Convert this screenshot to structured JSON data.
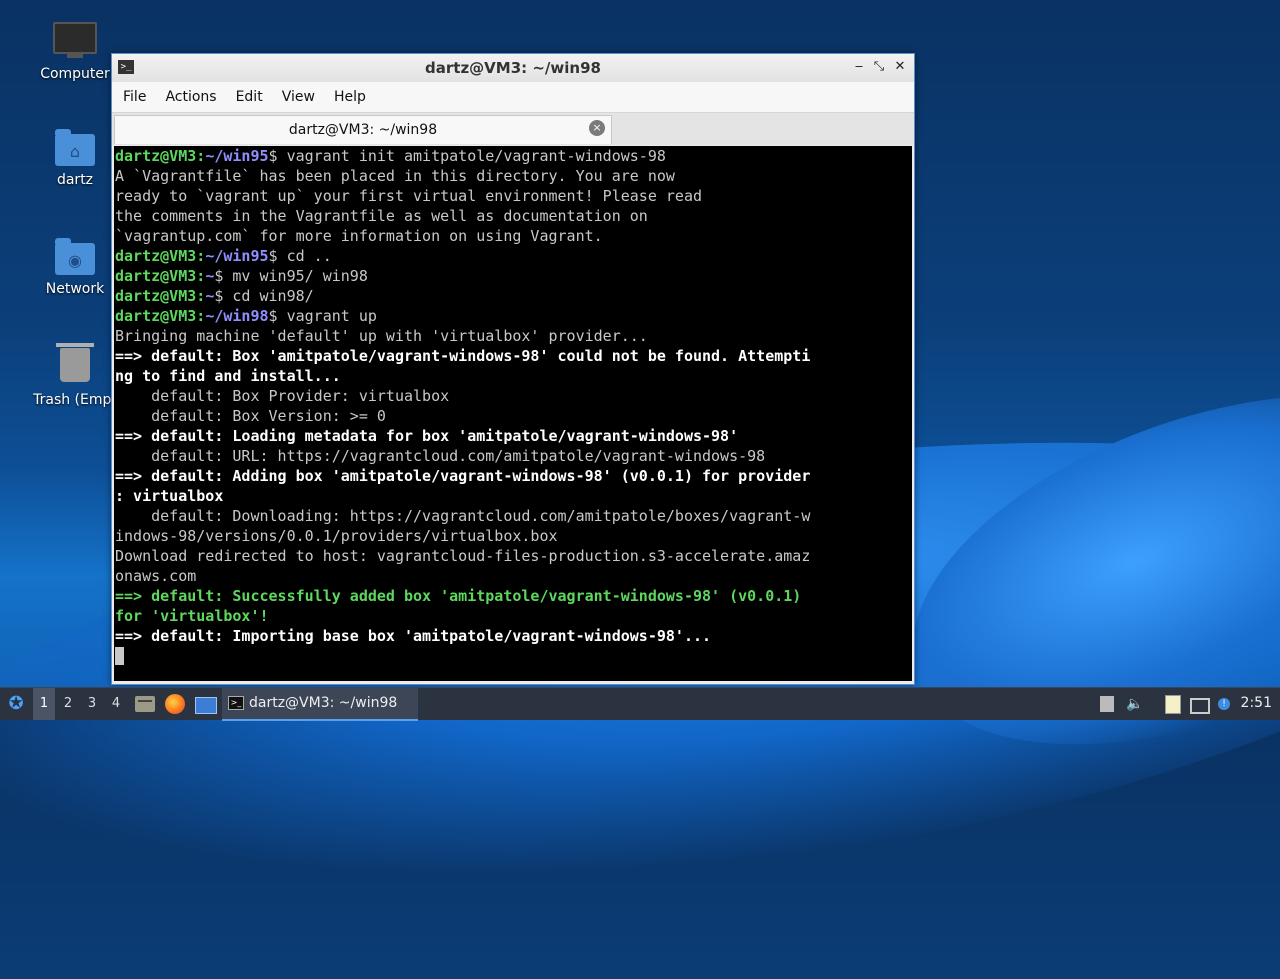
{
  "desktop": {
    "icons": [
      {
        "label": "Computer",
        "icon": "computer-icon"
      },
      {
        "label": "dartz",
        "icon": "home-folder-icon"
      },
      {
        "label": "Network",
        "icon": "network-folder-icon"
      },
      {
        "label": "Trash (Empt",
        "icon": "trash-icon"
      }
    ]
  },
  "window": {
    "title": "dartz@VM3: ~/win98",
    "controls": {
      "minimize": "‒",
      "maximize": "⤡",
      "close": "✕"
    },
    "menu": [
      "File",
      "Actions",
      "Edit",
      "View",
      "Help"
    ],
    "tab": {
      "label": "dartz@VM3: ~/win98",
      "close": "×"
    }
  },
  "terminal": {
    "lines": [
      {
        "type": "prompt",
        "user": "dartz@VM3",
        "path": "~/win95",
        "cmd": " vagrant init amitpatole/vagrant-windows-98"
      },
      {
        "type": "out",
        "text": "A `Vagrantfile` has been placed in this directory. You are now"
      },
      {
        "type": "out",
        "text": "ready to `vagrant up` your first virtual environment! Please read"
      },
      {
        "type": "out",
        "text": "the comments in the Vagrantfile as well as documentation on"
      },
      {
        "type": "out",
        "text": "`vagrantup.com` for more information on using Vagrant."
      },
      {
        "type": "prompt",
        "user": "dartz@VM3",
        "path": "~/win95",
        "cmd": " cd .."
      },
      {
        "type": "prompt",
        "user": "dartz@VM3",
        "path": "~",
        "cmd": " mv win95/ win98"
      },
      {
        "type": "prompt",
        "user": "dartz@VM3",
        "path": "~",
        "cmd": " cd win98/"
      },
      {
        "type": "prompt",
        "user": "dartz@VM3",
        "path": "~/win98",
        "cmd": " vagrant up"
      },
      {
        "type": "out",
        "text": "Bringing machine 'default' up with 'virtualbox' provider..."
      },
      {
        "type": "bold",
        "text": "==> default: Box 'amitpatole/vagrant-windows-98' could not be found. Attempti"
      },
      {
        "type": "bold",
        "text": "ng to find and install..."
      },
      {
        "type": "out",
        "text": "    default: Box Provider: virtualbox"
      },
      {
        "type": "out",
        "text": "    default: Box Version: >= 0"
      },
      {
        "type": "bold",
        "text": "==> default: Loading metadata for box 'amitpatole/vagrant-windows-98'"
      },
      {
        "type": "out",
        "text": "    default: URL: https://vagrantcloud.com/amitpatole/vagrant-windows-98"
      },
      {
        "type": "bold",
        "text": "==> default: Adding box 'amitpatole/vagrant-windows-98' (v0.0.1) for provider"
      },
      {
        "type": "bold",
        "text": ": virtualbox"
      },
      {
        "type": "out",
        "text": "    default: Downloading: https://vagrantcloud.com/amitpatole/boxes/vagrant-w"
      },
      {
        "type": "out",
        "text": "indows-98/versions/0.0.1/providers/virtualbox.box"
      },
      {
        "type": "out",
        "text": "Download redirected to host: vagrantcloud-files-production.s3-accelerate.amaz"
      },
      {
        "type": "out",
        "text": "onaws.com"
      },
      {
        "type": "green",
        "text": "==> default: Successfully added box 'amitpatole/vagrant-windows-98' (v0.0.1)"
      },
      {
        "type": "green",
        "text": "for 'virtualbox'!"
      },
      {
        "type": "bold",
        "text": "==> default: Importing base box 'amitpatole/vagrant-windows-98'..."
      },
      {
        "type": "cursor",
        "text": ""
      }
    ]
  },
  "taskbar": {
    "start_icon": "start-menu-icon",
    "workspaces": [
      "1",
      "2",
      "3",
      "4"
    ],
    "active_workspace": "1",
    "launchers": [
      "file-manager-icon",
      "firefox-icon",
      "desktop-icon"
    ],
    "task": {
      "label": "dartz@VM3: ~/win98"
    },
    "tray": [
      "network-status-icon",
      "volume-icon",
      "clipboard-icon",
      "display-icon",
      "notification-icon"
    ],
    "clock": "2:51"
  }
}
